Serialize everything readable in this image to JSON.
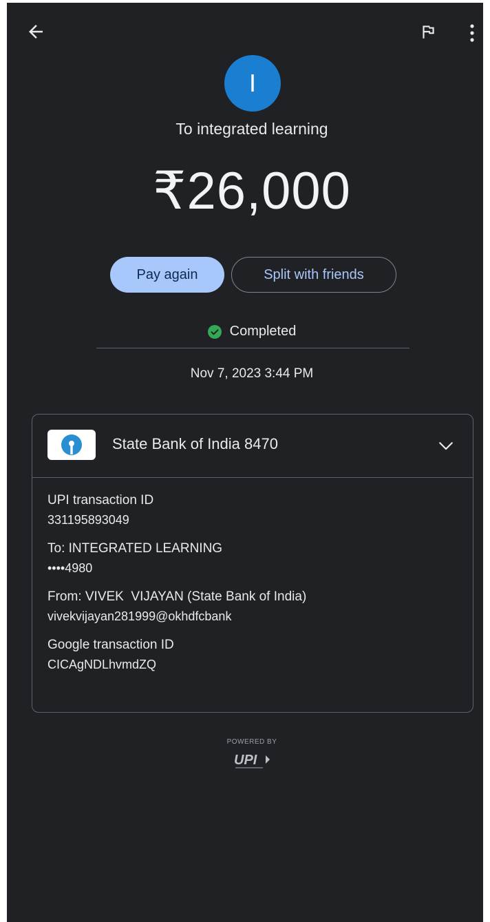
{
  "header": {
    "back_icon": "arrow-left-icon",
    "report_icon": "flag-icon",
    "menu_icon": "more-vert-icon"
  },
  "payee": {
    "avatar_initial": "I",
    "avatar_color": "#1a7fd0",
    "recipient_text": "To integrated learning"
  },
  "payment": {
    "amount": "₹26,000"
  },
  "actions": {
    "pay_again_label": "Pay again",
    "split_label": "Split with friends"
  },
  "status": {
    "text": "Completed",
    "color": "#34a853",
    "timestamp": "Nov 7, 2023 3:44 PM"
  },
  "account_card": {
    "bank_name": "State Bank of India 8470",
    "expand_icon": "chevron-down-icon",
    "details": [
      {
        "label": "UPI transaction ID",
        "value": "331195893049"
      },
      {
        "label": "To: INTEGRATED LEARNING",
        "value": "••••4980"
      },
      {
        "label": "From: VIVEK  VIJAYAN (State Bank of India)",
        "value": "vivekvijayan281999@okhdfcbank"
      },
      {
        "label": "Google transaction ID",
        "value": "CICAgNDLhvmdZQ"
      }
    ]
  },
  "footer": {
    "powered_by": "POWERED BY",
    "brand": "UPI"
  }
}
